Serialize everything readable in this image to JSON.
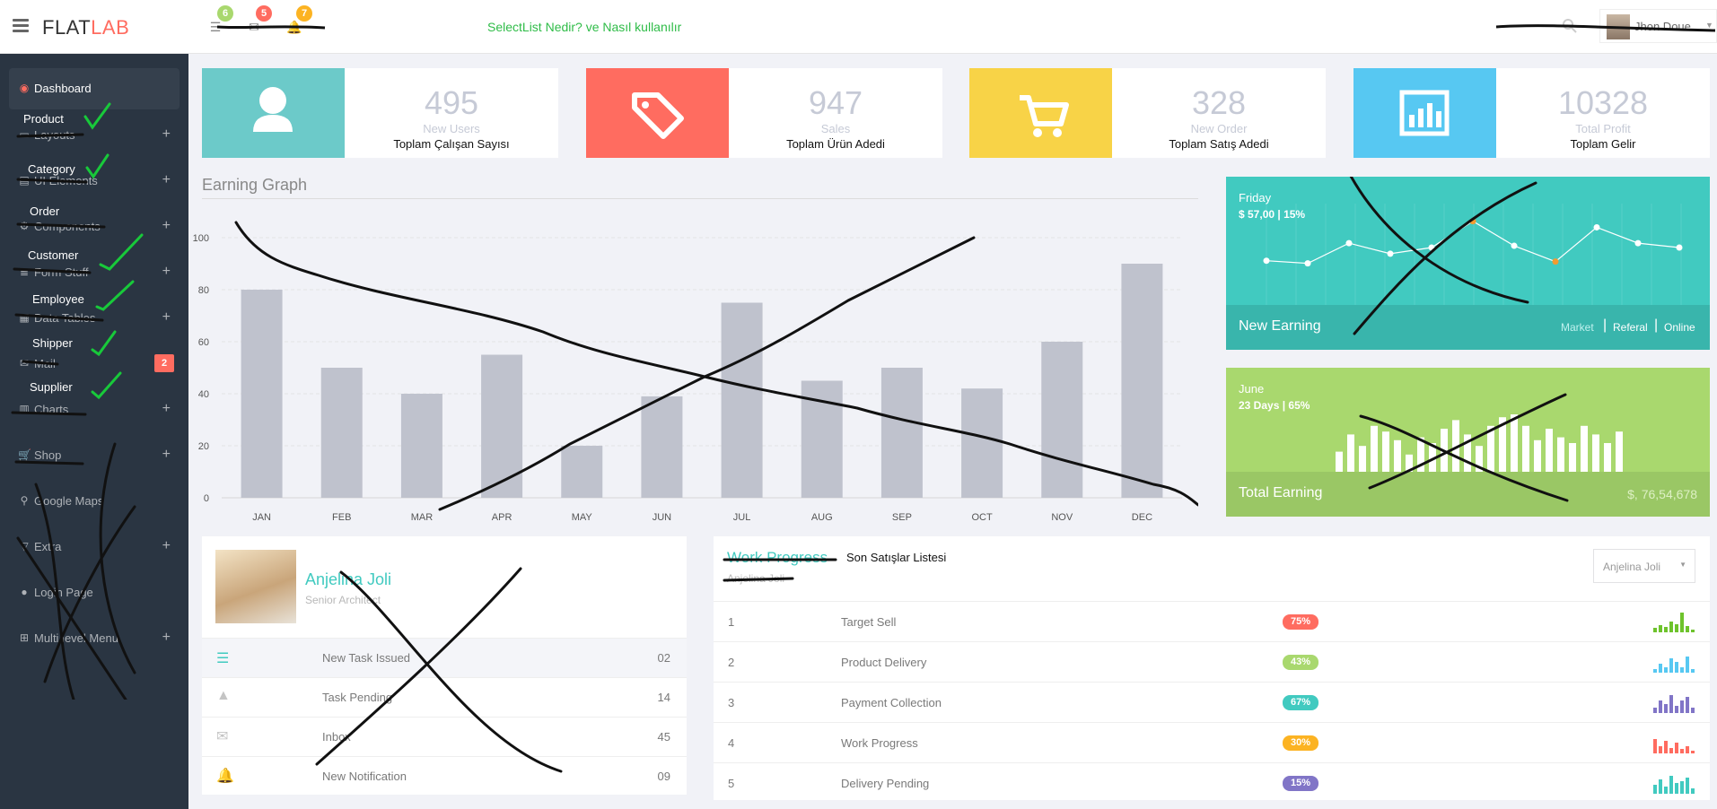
{
  "header": {
    "logo_a": "FLAT",
    "logo_b": "LAB",
    "badges": [
      "6",
      "5",
      "7"
    ],
    "page_heading": "SelectList Nedir? ve Nasıl kullanılır",
    "user_name": "Jhon Doue"
  },
  "sidebar": {
    "items": [
      {
        "label": "Dashboard",
        "icon": "dashboard-icon"
      },
      {
        "label": "Layouts",
        "icon": "laptop-icon"
      },
      {
        "label": "UI Elements",
        "icon": "book-icon"
      },
      {
        "label": "Components",
        "icon": "cogs-icon"
      },
      {
        "label": "Form Stuff",
        "icon": "tasks-icon"
      },
      {
        "label": "Data Tables",
        "icon": "th-icon"
      },
      {
        "label": "Mail",
        "icon": "envelope-icon"
      },
      {
        "label": "Charts",
        "icon": "bar-chart-icon"
      },
      {
        "label": "Shop",
        "icon": "shopping-cart-icon"
      },
      {
        "label": "Google Maps",
        "icon": "map-marker-icon"
      },
      {
        "label": "Extra",
        "icon": "glass-icon"
      },
      {
        "label": "Login Page",
        "icon": "user-icon"
      },
      {
        "label": "Multi level Menu",
        "icon": "sitemap-icon"
      }
    ],
    "mail_badge": "2",
    "handwritten": [
      "Product",
      "Category",
      "Order",
      "Customer",
      "Employee",
      "Shipper",
      "Supplier"
    ]
  },
  "stats": [
    {
      "value": "495",
      "sub": "New Users",
      "note": "Toplam Çalışan Sayısı",
      "color": "#6ccac9"
    },
    {
      "value": "947",
      "sub": "Sales",
      "note": "Toplam Ürün Adedi",
      "color": "#ff6c60"
    },
    {
      "value": "328",
      "sub": "New Order",
      "note": "Toplam Satış Adedi",
      "color": "#f8d347"
    },
    {
      "value": "10328",
      "sub": "Total Profit",
      "note": "Toplam Gelir",
      "color": "#57c8f2"
    }
  ],
  "graph": {
    "title": "Earning Graph"
  },
  "chart_data": {
    "type": "bar",
    "title": "Earning Graph",
    "categories": [
      "JAN",
      "FEB",
      "MAR",
      "APR",
      "MAY",
      "JUN",
      "JUL",
      "AUG",
      "SEP",
      "OCT",
      "NOV",
      "DEC"
    ],
    "values": [
      80,
      50,
      40,
      55,
      20,
      39,
      75,
      45,
      50,
      42,
      60,
      90
    ],
    "ylim": [
      0,
      100
    ],
    "yticks": [
      0,
      20,
      40,
      60,
      80,
      100
    ],
    "bar_color": "#bfc2cd",
    "grid": true
  },
  "panel_new": {
    "day": "Friday",
    "stat": "$ 57,00 | 15%",
    "title": "New Earning",
    "links": [
      "Market",
      "Referal",
      "Online"
    ],
    "points": [
      0.35,
      0.32,
      0.55,
      0.43,
      0.5,
      0.8,
      0.52,
      0.34,
      0.73,
      0.55,
      0.5
    ]
  },
  "panel_total": {
    "month": "June",
    "stat": "23 Days | 65%",
    "title": "Total Earning",
    "amount": "$, 76,54,678",
    "bars": [
      0.35,
      0.65,
      0.45,
      0.8,
      0.7,
      0.55,
      0.3,
      0.6,
      0.5,
      0.75,
      0.9,
      0.65,
      0.45,
      0.8,
      0.95,
      1.0,
      0.8,
      0.55,
      0.75,
      0.6,
      0.5,
      0.8,
      0.65,
      0.5,
      0.7
    ]
  },
  "profile": {
    "name": "Anjelina Joli",
    "title": "Senior Architect",
    "rows": [
      {
        "label": "New Task Issued",
        "value": "02",
        "icon": "tasks-icon"
      },
      {
        "label": "Task Pending",
        "value": "14",
        "icon": "warning-icon"
      },
      {
        "label": "Inbox",
        "value": "45",
        "icon": "envelope-icon"
      },
      {
        "label": "New Notification",
        "value": "09",
        "icon": "bell-icon"
      }
    ]
  },
  "work": {
    "title": "Work Progress",
    "subtitle": "Anjelina Joli",
    "handwritten_title": "Son Satışlar Listesi",
    "dropdown": "Anjelina Joli",
    "rows": [
      {
        "num": "1",
        "label": "Target Sell",
        "pct": "75%",
        "color": "#ff6c60",
        "spark_color": "#6ec32c"
      },
      {
        "num": "2",
        "label": "Product Delivery",
        "pct": "43%",
        "color": "#a9d86e",
        "spark_color": "#57c8f2"
      },
      {
        "num": "3",
        "label": "Payment Collection",
        "pct": "67%",
        "color": "#41cac0",
        "spark_color": "#8175c7"
      },
      {
        "num": "4",
        "label": "Work Progress",
        "pct": "30%",
        "color": "#fcb322",
        "spark_color": "#ff6c60"
      },
      {
        "num": "5",
        "label": "Delivery Pending",
        "pct": "15%",
        "color": "#8175c7",
        "spark_color": "#41cac0"
      }
    ]
  }
}
